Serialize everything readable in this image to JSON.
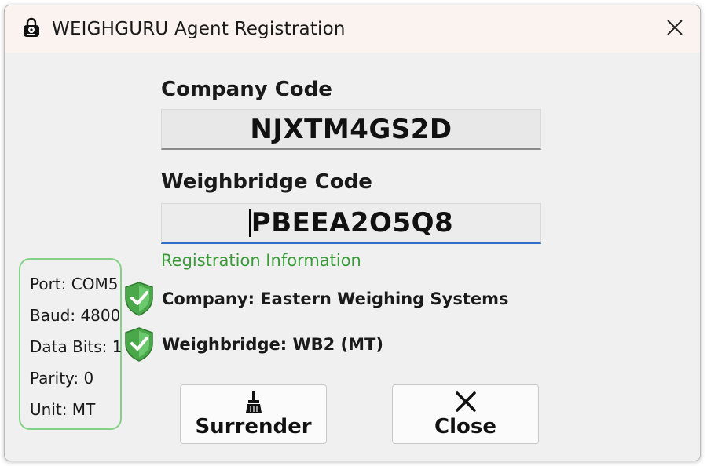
{
  "window": {
    "title": "WEIGHGURU Agent Registration"
  },
  "form": {
    "company_label": "Company Code",
    "company_value": "NJXTM4GS2D",
    "weighbridge_label": "Weighbridge Code",
    "weighbridge_value": "PBEEA2O5Q8"
  },
  "registration": {
    "heading": "Registration Information",
    "company_status": "Company: Eastern Weighing Systems",
    "weighbridge_status": "Weighbridge: WB2 (MT)"
  },
  "settings": {
    "port": "Port: COM5",
    "baud": "Baud: 4800",
    "data_bits": "Data Bits: 1",
    "parity": "Parity: 0",
    "unit": "Unit: MT"
  },
  "buttons": {
    "surrender_label": "Surrender",
    "close_label": "Close"
  },
  "icons": {
    "app": "padlock-icon",
    "title_close": "close-icon",
    "verified": "check-shield-icon",
    "surrender": "broom-icon",
    "close": "close-icon"
  },
  "colors": {
    "accent_blue": "#2f6fc9",
    "success_green": "#3a9a3a",
    "settings_border": "#86d08a",
    "titlebar_bg": "#fbf3ef"
  }
}
